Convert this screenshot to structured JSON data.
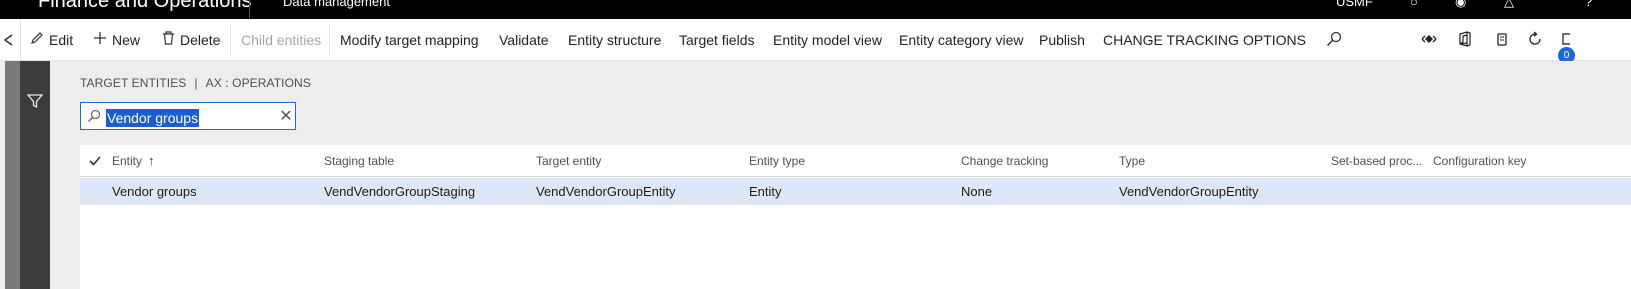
{
  "topbar": {
    "app_title": "Finance and Operations",
    "module": "Data management",
    "company": "USMF"
  },
  "action_pane": {
    "edit": "Edit",
    "new": "New",
    "delete": "Delete",
    "child_entities": "Child entities",
    "modify_target_mapping": "Modify target mapping",
    "validate": "Validate",
    "entity_structure": "Entity structure",
    "target_fields": "Target fields",
    "entity_model_view": "Entity model view",
    "entity_category_view": "Entity category view",
    "publish": "Publish",
    "change_tracking": "CHANGE TRACKING",
    "options": "OPTIONS",
    "notification_count": "0"
  },
  "breadcrumb": {
    "part1": "TARGET ENTITIES",
    "separator": "|",
    "part2": "AX : OPERATIONS"
  },
  "search": {
    "value": "Vendor groups"
  },
  "grid": {
    "columns": [
      "Entity",
      "Staging table",
      "Target entity",
      "Entity type",
      "Change tracking",
      "Type",
      "Set-based proc...",
      "Configuration key"
    ],
    "rows": [
      [
        "Vendor groups",
        "VendVendorGroupStaging",
        "VendVendorGroupEntity",
        "Entity",
        "None",
        "VendVendorGroupEntity",
        "",
        ""
      ]
    ]
  },
  "colors": {
    "accent": "#1a6bd6",
    "selected_row": "#dce8f7",
    "content_bg": "#ededed",
    "nav_dark": "#3c3c3c"
  },
  "icons": [
    "pencil-icon",
    "plus-icon",
    "trash-icon",
    "search-icon",
    "diamond-icon",
    "office-icon",
    "notification-icon",
    "refresh-icon",
    "filter-icon",
    "checkmark-icon",
    "clear-icon",
    "sort-ascending-icon"
  ]
}
